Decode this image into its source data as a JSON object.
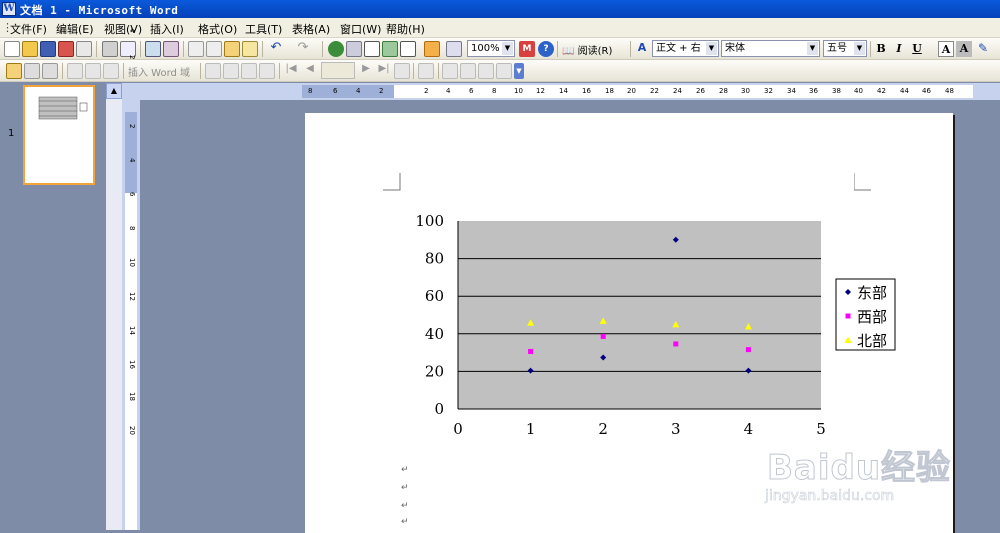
{
  "window": {
    "title": "文档 1 - Microsoft Word"
  },
  "menu": [
    "文件(F)",
    "编辑(E)",
    "视图(V)",
    "插入(I)",
    "格式(O)",
    "工具(T)",
    "表格(A)",
    "窗口(W)",
    "帮助(H)"
  ],
  "toolbar": {
    "zoom": "100%",
    "read_label": "阅读(R)",
    "style": "正文 + 右",
    "font": "宋体",
    "size": "五号",
    "bold": "B",
    "italic": "I",
    "underline": "U",
    "font_color": "A",
    "char_shading": "A",
    "insert_field": "插入 Word 域"
  },
  "thumbnail": {
    "page_number": "1"
  },
  "ruler": {
    "h_ticks": [
      "8",
      "6",
      "4",
      "2",
      "2",
      "4",
      "6",
      "8",
      "10",
      "12",
      "14",
      "16",
      "18",
      "20",
      "22",
      "24",
      "26",
      "28",
      "30",
      "32",
      "34",
      "36",
      "38",
      "40",
      "42",
      "44",
      "46",
      "48"
    ],
    "v_ticks": [
      "4",
      "2",
      "2",
      "4",
      "6",
      "8",
      "10",
      "12",
      "14",
      "16",
      "18",
      "20"
    ]
  },
  "chart_data": {
    "type": "scatter",
    "xlim": [
      0,
      5
    ],
    "ylim": [
      0,
      100
    ],
    "x_ticks": [
      "0",
      "1",
      "2",
      "3",
      "4",
      "5"
    ],
    "y_ticks": [
      "0",
      "20",
      "40",
      "60",
      "80",
      "100"
    ],
    "grid": true,
    "legend": "right",
    "plot_bg": "#c0c0c0",
    "series": [
      {
        "name": "东部",
        "color": "#000080",
        "marker": "diamond",
        "x": [
          1,
          2,
          3,
          4
        ],
        "y": [
          20.4,
          27.4,
          90,
          20.4
        ]
      },
      {
        "name": "西部",
        "color": "#ff00ff",
        "marker": "square",
        "x": [
          1,
          2,
          3,
          4
        ],
        "y": [
          30.6,
          38.6,
          34.6,
          31.6
        ]
      },
      {
        "name": "北部",
        "color": "#ffff00",
        "marker": "triangle",
        "x": [
          1,
          2,
          3,
          4
        ],
        "y": [
          45.9,
          46.9,
          45,
          43.9
        ]
      }
    ]
  },
  "watermark": {
    "brand": "Baidu经验",
    "url": "jingyan.baidu.com"
  }
}
